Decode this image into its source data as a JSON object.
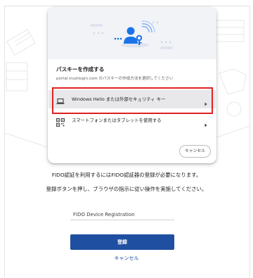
{
  "dialog": {
    "title": "パスキーを作成する",
    "subtitle": "portal.trustlogin.com のパスキーの作成方法を選択してください",
    "options": [
      {
        "label": "Windows Hello または外部セキュリティ キー",
        "icon": "laptop-icon"
      },
      {
        "label": "スマートフォンまたはタブレットを使用する",
        "icon": "qr-code-icon"
      }
    ],
    "cancel_label": "キャンセル"
  },
  "page": {
    "info_line_1": "FIDO認証を利用するにはFIDO認証器の登録が必要になります。",
    "info_line_2": "登録ボタンを押し、ブラウザの指示に従い操作を実施してください。",
    "device_name_value": "FIDO Device Registration",
    "register_label": "登録",
    "cancel_label": "キャンセル"
  },
  "colors": {
    "primary": "#1f4fa0",
    "highlight": "#e02020",
    "hero_background": "#f1f3f7",
    "selected_option": "#e8e8ea"
  }
}
